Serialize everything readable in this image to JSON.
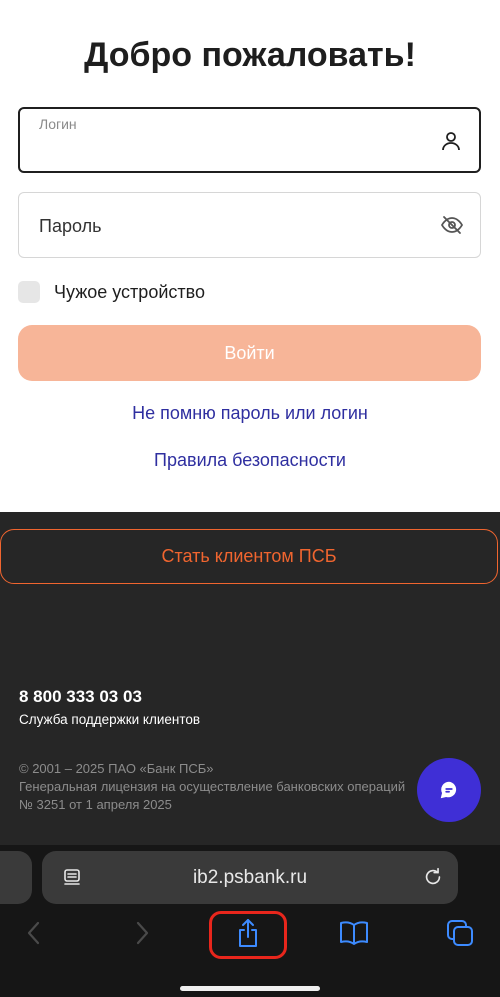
{
  "title": "Добро пожаловать!",
  "login": {
    "label": "Логин",
    "value": ""
  },
  "password": {
    "placeholder": "Пароль"
  },
  "foreign_device": {
    "label": "Чужое устройство",
    "checked": false
  },
  "submit_label": "Войти",
  "links": {
    "forgot": "Не помню пароль или логин",
    "rules": "Правила безопасности"
  },
  "footer": {
    "become_client": "Стать клиентом ПСБ",
    "phone": "8 800 333 03 03",
    "phone_caption": "Служба поддержки клиентов",
    "copyright": "© 2001 – 2025 ПАО «Банк ПСБ»",
    "license": "Генеральная лицензия на осуществление банковских операций № 3251 от 1 апреля 2025"
  },
  "browser": {
    "url": "ib2.psbank.ru"
  },
  "icons": {
    "login": "person-icon",
    "password": "eye-off-icon",
    "chat": "chat-icon",
    "page": "page-icon",
    "reload": "reload-icon",
    "back": "chevron-left-icon",
    "forward": "chevron-right-icon",
    "share": "share-icon",
    "bookmarks": "book-icon",
    "tabs": "tabs-icon"
  },
  "colors": {
    "accent": "#f0652f",
    "submit_disabled": "#f7b598",
    "link": "#2f2fa0",
    "chat_button": "#3f2fd6",
    "footer_bg": "#262626",
    "highlight": "#e8261c"
  }
}
